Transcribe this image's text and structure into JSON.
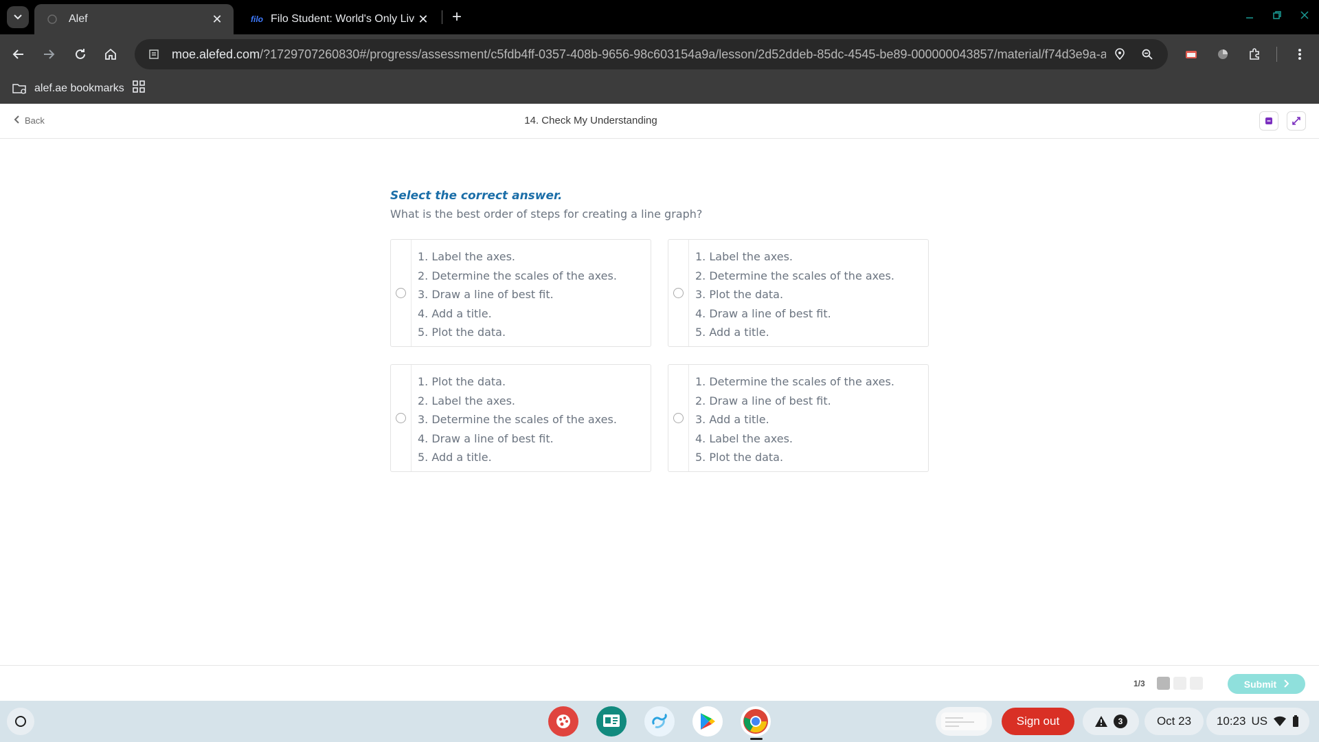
{
  "browser": {
    "tabs": [
      {
        "title": "Alef",
        "active": true
      },
      {
        "favicon": "filo",
        "title": "Filo Student: World's Only Live I",
        "active": false
      }
    ],
    "url_host": "moe.alefed.com",
    "url_path": "/?1729707260830#/progress/assessment/c5fdb4ff-0357-408b-9656-98c603154a9a/lesson/2d52ddeb-85dc-4545-be89-000000043857/material/f74d3e9a-a...",
    "bookmark_folder": "alef.ae bookmarks"
  },
  "header": {
    "back_label": "Back",
    "title": "14. Check My Understanding"
  },
  "question": {
    "instruction": "Select the correct answer.",
    "prompt": "What is the best order of steps for creating a line graph?",
    "options": [
      {
        "steps": [
          "1. Label the axes.",
          "2. Determine the scales of the axes.",
          "3. Draw a line of best fit.",
          "4. Add a title.",
          "5. Plot the data."
        ]
      },
      {
        "steps": [
          "1. Label the axes.",
          "2. Determine the scales of the axes.",
          "3. Plot the data.",
          "4. Draw a line of best fit.",
          "5. Add a title."
        ]
      },
      {
        "steps": [
          "1. Plot the data.",
          "2. Label the axes.",
          "3. Determine the scales of the axes.",
          "4. Draw a line of best fit.",
          "5. Add a title."
        ]
      },
      {
        "steps": [
          "1. Determine the scales of the axes.",
          "2. Draw a line of best fit.",
          "3. Add a title.",
          "4. Label the axes.",
          "5. Plot the data."
        ]
      }
    ]
  },
  "footer": {
    "progress": "1/3",
    "submit_label": "Submit"
  },
  "shelf": {
    "signout_label": "Sign out",
    "notification_count": "3",
    "date": "Oct 23",
    "time": "10:23",
    "locale": "US"
  },
  "colors": {
    "accent_teal": "#8fe0dc",
    "instruction_blue": "#1b6ea8",
    "signout_red": "#d93025"
  }
}
